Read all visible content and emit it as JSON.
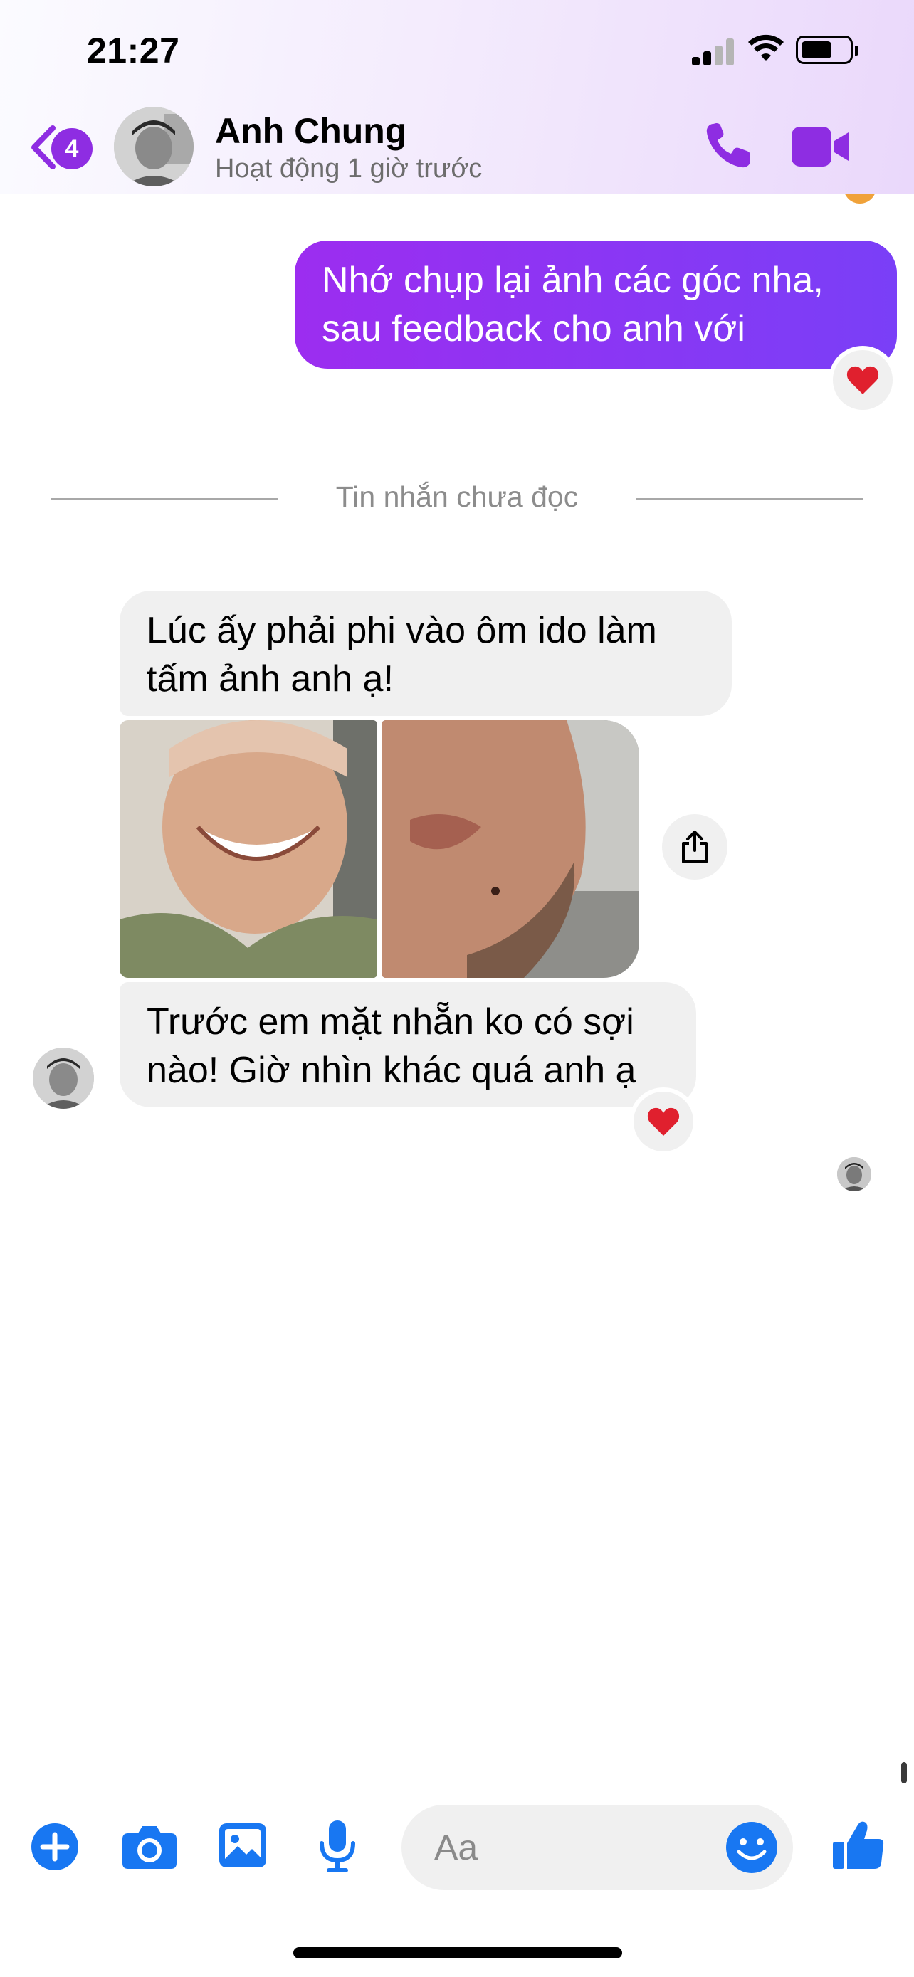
{
  "status_bar": {
    "time": "21:27"
  },
  "header": {
    "unread_count": "4",
    "contact_name": "Anh Chung",
    "contact_status": "Hoạt động 1 giờ trước"
  },
  "messages": {
    "outgoing_1": {
      "line1": "Nhớ chụp lại ảnh các góc nha,",
      "line2": "sau feedback cho anh với"
    },
    "divider": "Tin nhắn chưa đọc",
    "incoming_1": {
      "line1": "Lúc ấy phải phi vào ôm ido làm",
      "line2": "tấm ảnh anh ạ!"
    },
    "incoming_2": {
      "line1": "Trước em mặt nhẵn ko có sợi",
      "line2": "nào! Giờ nhìn khác quá anh ạ"
    }
  },
  "composer": {
    "placeholder": "Aa"
  },
  "colors": {
    "accent": "#8e2de2",
    "outgoing_bubble": "#9c2df0",
    "incoming_bubble": "#f0f0f0",
    "toolbar_blue": "#1877f2"
  },
  "icons": [
    "back-icon",
    "phone-icon",
    "video-icon",
    "heart-icon",
    "share-icon",
    "plus-icon",
    "camera-icon",
    "image-icon",
    "microphone-icon",
    "emoji-icon",
    "thumbs-up-icon"
  ]
}
